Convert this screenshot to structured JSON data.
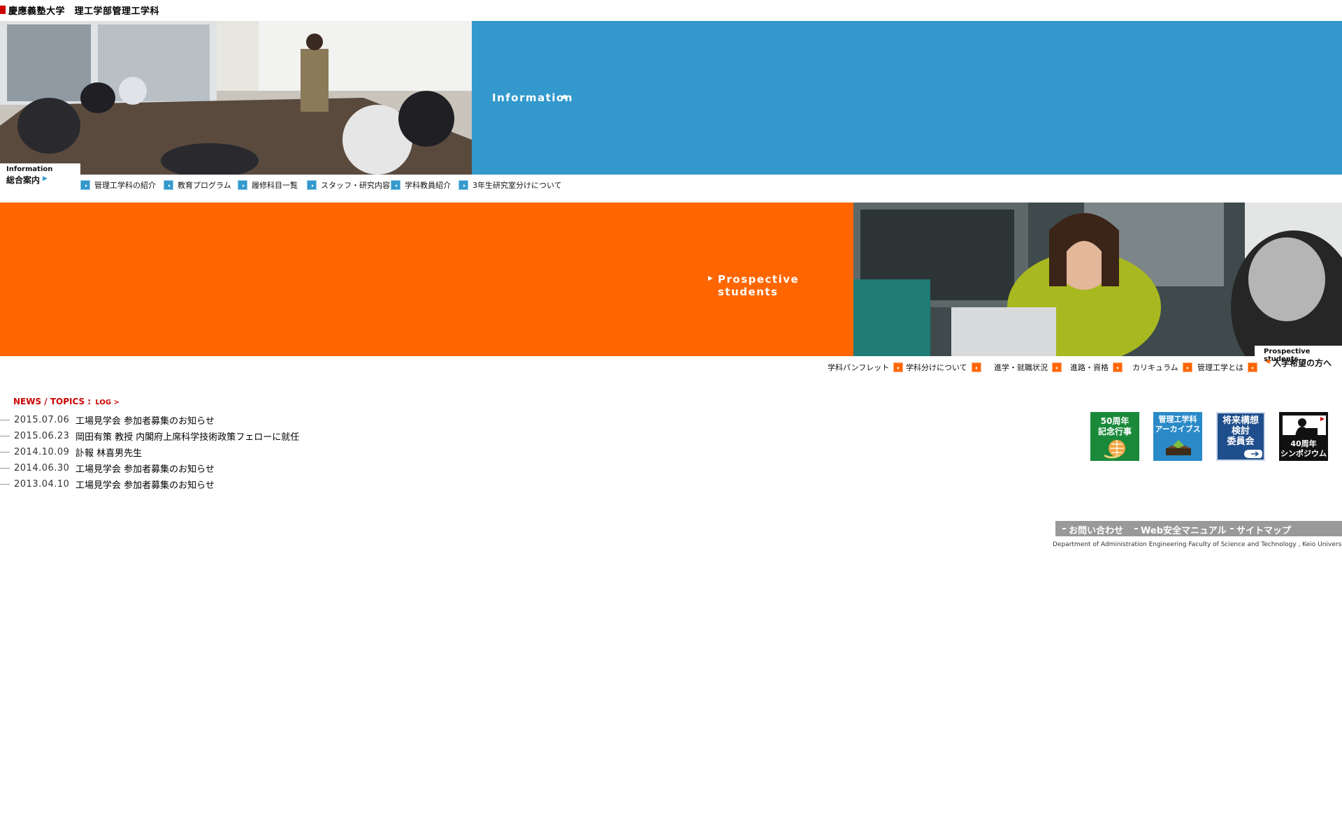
{
  "header": {
    "title": "慶應義塾大学　理工学部管理工学科"
  },
  "information": {
    "band_label": "Information",
    "tag_en": "Information",
    "tag_jp": "総合案内",
    "nav": [
      "管理工学科の紹介",
      "教育プログラム",
      "履修科目一覧",
      "スタッフ・研究内容",
      "学科教員紹介",
      "3年生研究室分けについて"
    ]
  },
  "prospective": {
    "band_label": "Prospective students",
    "tag_en": "Prospective students",
    "tag_jp": "入学希望の方へ",
    "nav": [
      "学科パンフレット",
      "学科分けについて",
      "進学・就職状況",
      "進路・資格",
      "カリキュラム",
      "管理工学とは"
    ]
  },
  "news": {
    "heading": "NEWS / TOPICS :",
    "log_link": "LOG >",
    "items": [
      {
        "date": "2015.07.06",
        "text": "工場見学会 参加者募集のお知らせ"
      },
      {
        "date": "2015.06.23",
        "text": "岡田有策 教授 内閣府上席科学技術政策フェローに就任"
      },
      {
        "date": "2014.10.09",
        "text": "訃報 林喜男先生"
      },
      {
        "date": "2014.06.30",
        "text": "工場見学会 参加者募集のお知らせ"
      },
      {
        "date": "2013.04.10",
        "text": "工場見学会 参加者募集のお知らせ"
      }
    ]
  },
  "banners": [
    {
      "line1": "50周年",
      "line2": "記念行事",
      "color": "#1a8a3a"
    },
    {
      "line1": "管理工学科",
      "line2": "アーカイブス",
      "color": "#2a8ac8"
    },
    {
      "line1": "将来構想",
      "line2": "検討",
      "line3": "委員会",
      "color": "#1f4e8c"
    },
    {
      "line1": "40周年",
      "line2": "シンポジウム",
      "color": "#111111"
    }
  ],
  "footer": {
    "links": [
      "お問い合わせ",
      "Web安全マニュアル",
      "サイトマップ"
    ],
    "text": "Department of Administration Engineering Faculty of Science and Technology , Keio University"
  },
  "colors": {
    "info_blue": "#3399cc",
    "prospective_orange": "#ff6600",
    "news_red": "#cc0000",
    "footer_gray": "#999999"
  }
}
